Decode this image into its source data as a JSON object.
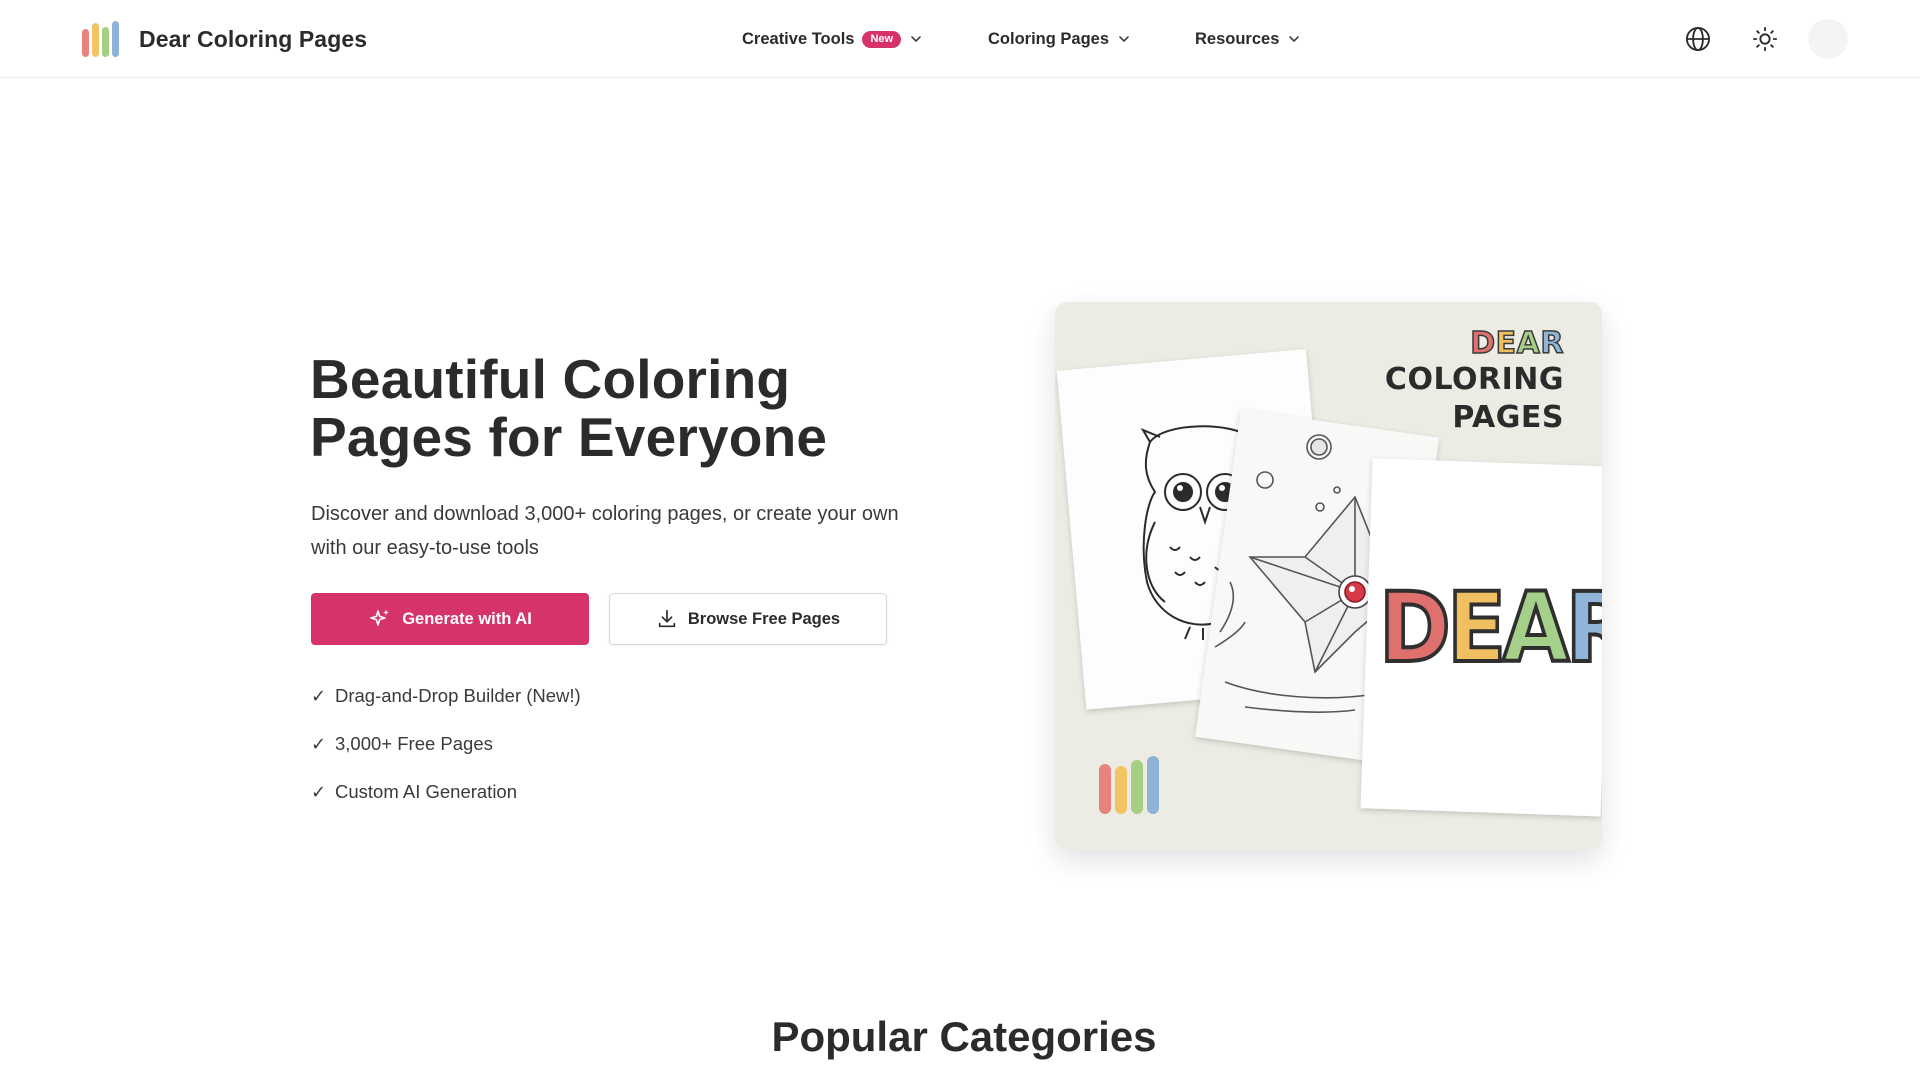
{
  "colors": {
    "accent": "#d6336c",
    "logo_bars": [
      "#e8827f",
      "#f2c463",
      "#a6cf85",
      "#8fb3d6"
    ],
    "card_background": "#ececE4",
    "dear_letters": [
      "#e0706e",
      "#f0c060",
      "#a5d08a",
      "#8fb5d8"
    ]
  },
  "header": {
    "brand_name": "Dear Coloring Pages",
    "nav": {
      "creative_tools": "Creative Tools",
      "new_badge": "New",
      "coloring_pages": "Coloring Pages",
      "resources": "Resources"
    },
    "icons": [
      "globe-icon",
      "sun-icon"
    ]
  },
  "hero": {
    "title": "Beautiful Coloring Pages for Everyone",
    "description": "Discover and download 3,000+ coloring pages, or create your own with our easy-to-use tools",
    "primary_button": "Generate with AI",
    "secondary_button": "Browse Free Pages",
    "features": [
      "Drag-and-Drop Builder (New!)",
      "3,000+ Free Pages",
      "Custom AI Generation"
    ],
    "card": {
      "small_word": "DEAR",
      "line1": "COLORING",
      "line2": "PAGES",
      "big_word": "DEAR"
    }
  },
  "sections": {
    "popular_categories": "Popular Categories"
  }
}
